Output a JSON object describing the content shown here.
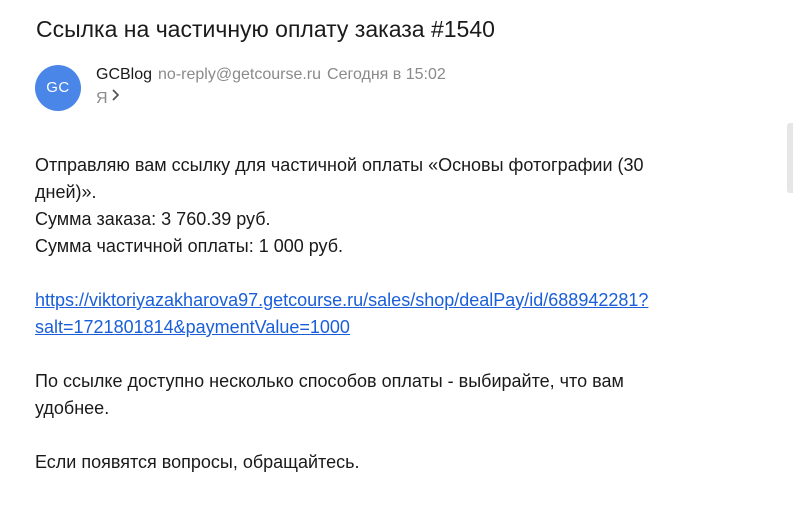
{
  "email": {
    "subject": "Ссылка на частичную оплату заказа #1540",
    "sender": {
      "avatar_initials": "GC",
      "avatar_color": "#4a86e8",
      "name": "GCBlog",
      "email": "no-reply@getcourse.ru",
      "time": "Сегодня в 15:02"
    },
    "recipient": "Я",
    "recipient_icon": "chevron-right-icon",
    "body": {
      "line1": "Отправляю вам ссылку для частичной оплаты «Основы фотографии (30",
      "line2": "дней)».",
      "line3": "Сумма заказа: 3 760.39 руб.",
      "line4": "Сумма частичной оплаты: 1 000 руб.",
      "link_line1": "https://viktoriyazakharova97.getcourse.ru/sales/shop/dealPay/id/688942281?",
      "link_line2": "salt=1721801814&paymentValue=1000",
      "line5": "По ссылке доступно несколько способов оплаты - выбирайте, что вам",
      "line6": "удобнее.",
      "line7": "Если появятся вопросы, обращайтесь."
    },
    "link_color": "#1a5fd9"
  }
}
